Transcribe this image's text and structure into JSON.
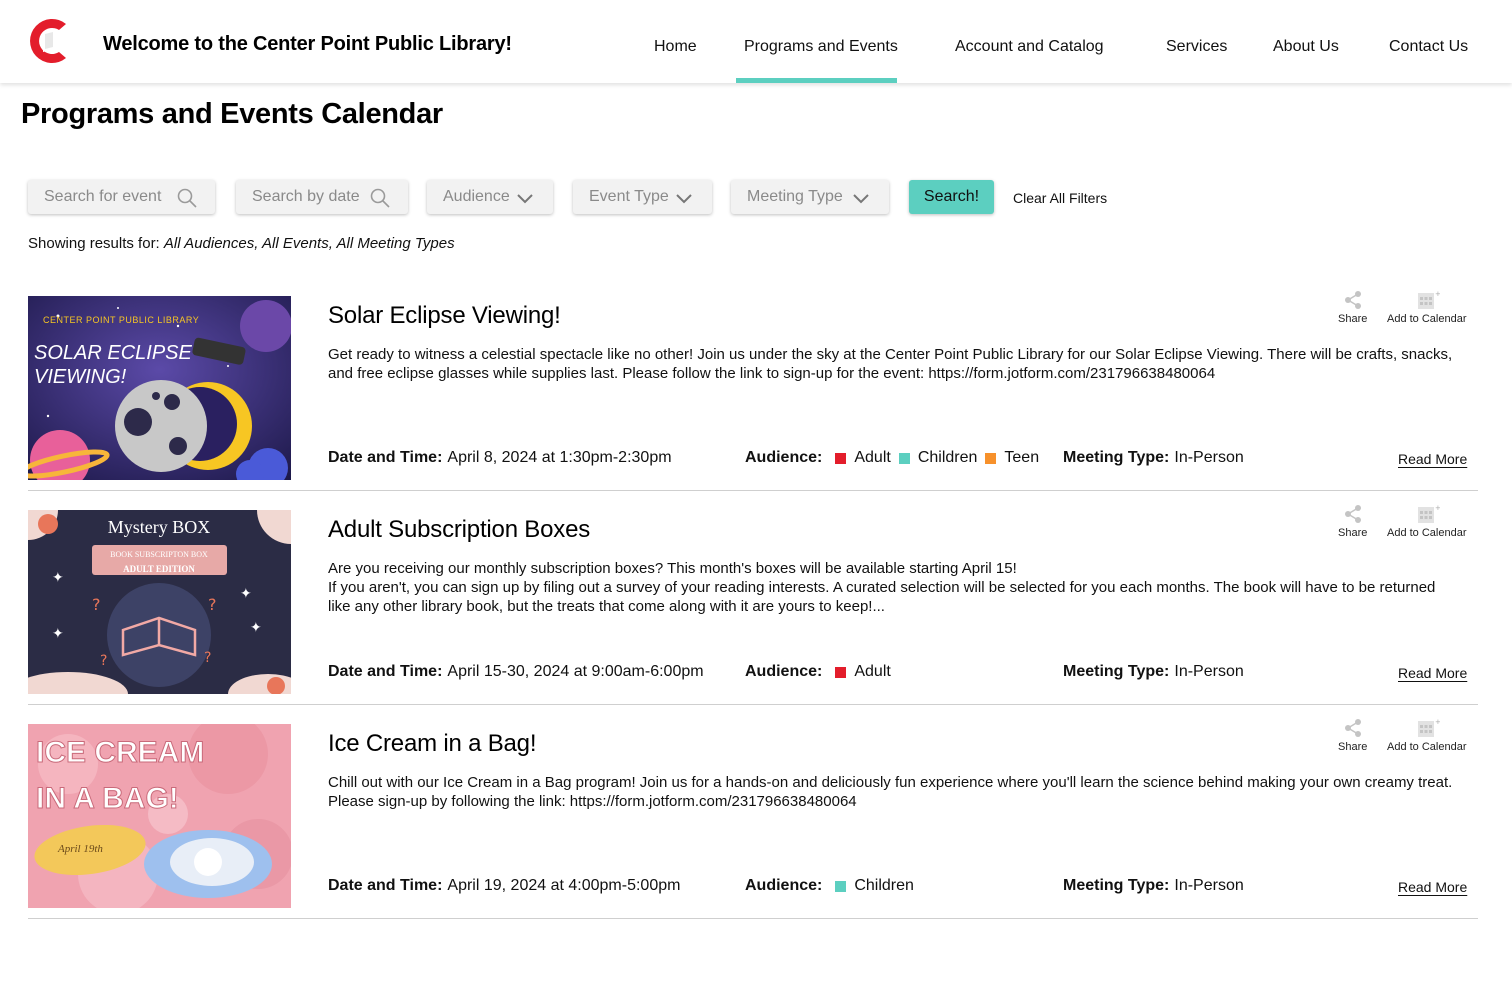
{
  "header": {
    "site_title": "Welcome to the Center Point Public Library!",
    "nav": [
      "Home",
      "Programs and Events",
      "Account and Catalog",
      "Services",
      "About Us",
      "Contact Us"
    ],
    "active_nav": "Programs and Events"
  },
  "page_title": "Programs and Events Calendar",
  "filters": {
    "search_event_placeholder": "Search for event",
    "search_date_placeholder": "Search by date",
    "audience": "Audience",
    "event_type": "Event Type",
    "meeting_type": "Meeting Type",
    "search_button": "Search!",
    "clear_button": "Clear All Filters"
  },
  "results": {
    "label": "Showing results for: ",
    "value": "All Audiences, All Events, All Meeting Types"
  },
  "labels": {
    "date_time": "Date and Time:",
    "audience": "Audience:",
    "meeting_type": "Meeting Type:",
    "share": "Share",
    "add_to_calendar": "Add to Calendar",
    "read_more": "Read More"
  },
  "audience_colors": {
    "Adult": "#e31d2b",
    "Children": "#5ccfc0",
    "Teen": "#f7912b"
  },
  "accent_color": "#5ccfc0",
  "events": [
    {
      "title": "Solar Eclipse Viewing!",
      "description": "Get ready to witness a celestial spectacle like no other! Join us under the sky at the Center Point Public Library for our Solar Eclipse Viewing. There will be crafts, snacks, and free eclipse glasses while supplies last. Please follow the link to sign-up for the event: https://form.jotform.com/231796638480064",
      "date_time": "April 8, 2024 at 1:30pm-2:30pm",
      "audience": [
        "Adult",
        "Children",
        "Teen"
      ],
      "meeting_type": "In-Person",
      "image_text": {
        "line1": "CENTER POINT PUBLIC LIBRARY",
        "line2": "SOLAR ECLIPSE",
        "line3": "VIEWING!"
      }
    },
    {
      "title": "Adult Subscription Boxes",
      "description": "Are you receiving our monthly subscription boxes? This month's boxes will be available starting April 15!\nIf you aren't, you can sign up by filing out a survey of your reading interests. A curated selection will be selected for you each months. The book will have to be returned like any other library book, but the treats that come along with it are yours to keep!...",
      "date_time": "April 15-30, 2024 at 9:00am-6:00pm",
      "audience": [
        "Adult"
      ],
      "meeting_type": "In-Person",
      "image_text": {
        "line1": "Mystery BOX",
        "line2": "BOOK SUBSCRIPTON BOX",
        "line3": "ADULT EDITION"
      }
    },
    {
      "title": "Ice Cream in a Bag!",
      "description": "Chill out with our Ice Cream in a Bag program! Join us for a hands-on and deliciously fun experience where you'll learn the science behind making your own creamy treat. Please sign-up by following the link: https://form.jotform.com/231796638480064",
      "date_time": "April 19, 2024 at 4:00pm-5:00pm",
      "audience": [
        "Children"
      ],
      "meeting_type": "In-Person",
      "image_text": {
        "line1": "ICE CREAM",
        "line2": "IN A BAG!",
        "line3": "April 19th"
      }
    }
  ]
}
